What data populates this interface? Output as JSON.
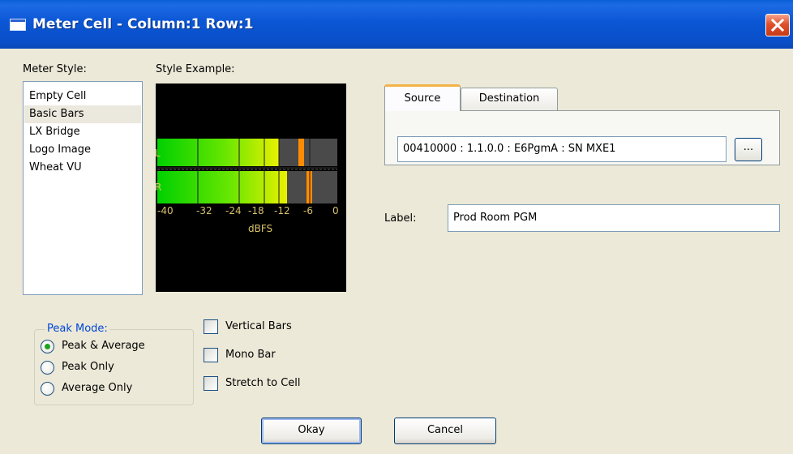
{
  "window": {
    "title": "Meter Cell - Column:1 Row:1"
  },
  "meter_style": {
    "label": "Meter Style:",
    "items": [
      "Empty Cell",
      "Basic Bars",
      "LX Bridge",
      "Logo Image",
      "Wheat VU"
    ],
    "selected": "Basic Bars"
  },
  "style_example": {
    "label": "Style Example:",
    "channels": [
      "L",
      "R"
    ],
    "scale_labels": [
      "-40",
      "-32",
      "-24",
      "-18",
      "-12",
      "-6",
      "0"
    ],
    "unit": "dBFS"
  },
  "tabs": {
    "source": "Source",
    "destination": "Destination",
    "active": "Source"
  },
  "source": {
    "value": "00410000 : 1.1.0.0 : E6PgmA : SN MXE1",
    "browse_label": "..."
  },
  "label_field": {
    "label": "Label:",
    "value": "Prod Room PGM"
  },
  "peak_mode": {
    "title": "Peak Mode:",
    "options": [
      "Peak & Average",
      "Peak Only",
      "Average Only"
    ],
    "selected": "Peak & Average"
  },
  "options": {
    "vertical_bars": {
      "label": "Vertical Bars",
      "checked": false
    },
    "mono_bar": {
      "label": "Mono Bar",
      "checked": false
    },
    "stretch_to_cell": {
      "label": "Stretch to Cell",
      "checked": false
    }
  },
  "buttons": {
    "okay": "Okay",
    "cancel": "Cancel"
  },
  "colors": {
    "title_bar": "#0a4fc9",
    "dialog_bg": "#ece9d8",
    "peak_marker": "#ff8c00",
    "group_title": "#0046d5"
  }
}
